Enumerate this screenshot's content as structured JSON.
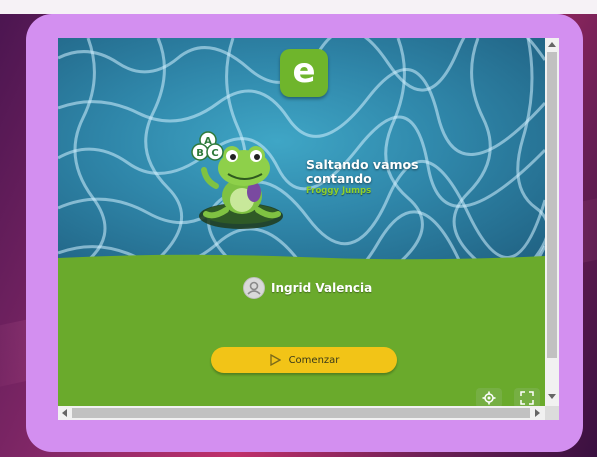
{
  "activity": {
    "logo_letter": "e",
    "title": "Saltando vamos contando",
    "subtitle": "Froggy Jumps",
    "frog_bubbles": [
      "A",
      "B",
      "C"
    ]
  },
  "user": {
    "name": "Ingrid Valencia"
  },
  "start_button": {
    "label": "Comenzar"
  },
  "icons": {
    "settings": "gear-icon",
    "fullscreen": "fullscreen-icon",
    "play": "play-icon",
    "avatar": "user-icon"
  },
  "colors": {
    "frame": "#d38ff0",
    "panel_green": "#6aaa2c",
    "logo_green": "#6fb52c",
    "button_yellow": "#f2c417",
    "water_blue": "#2f86a9"
  }
}
